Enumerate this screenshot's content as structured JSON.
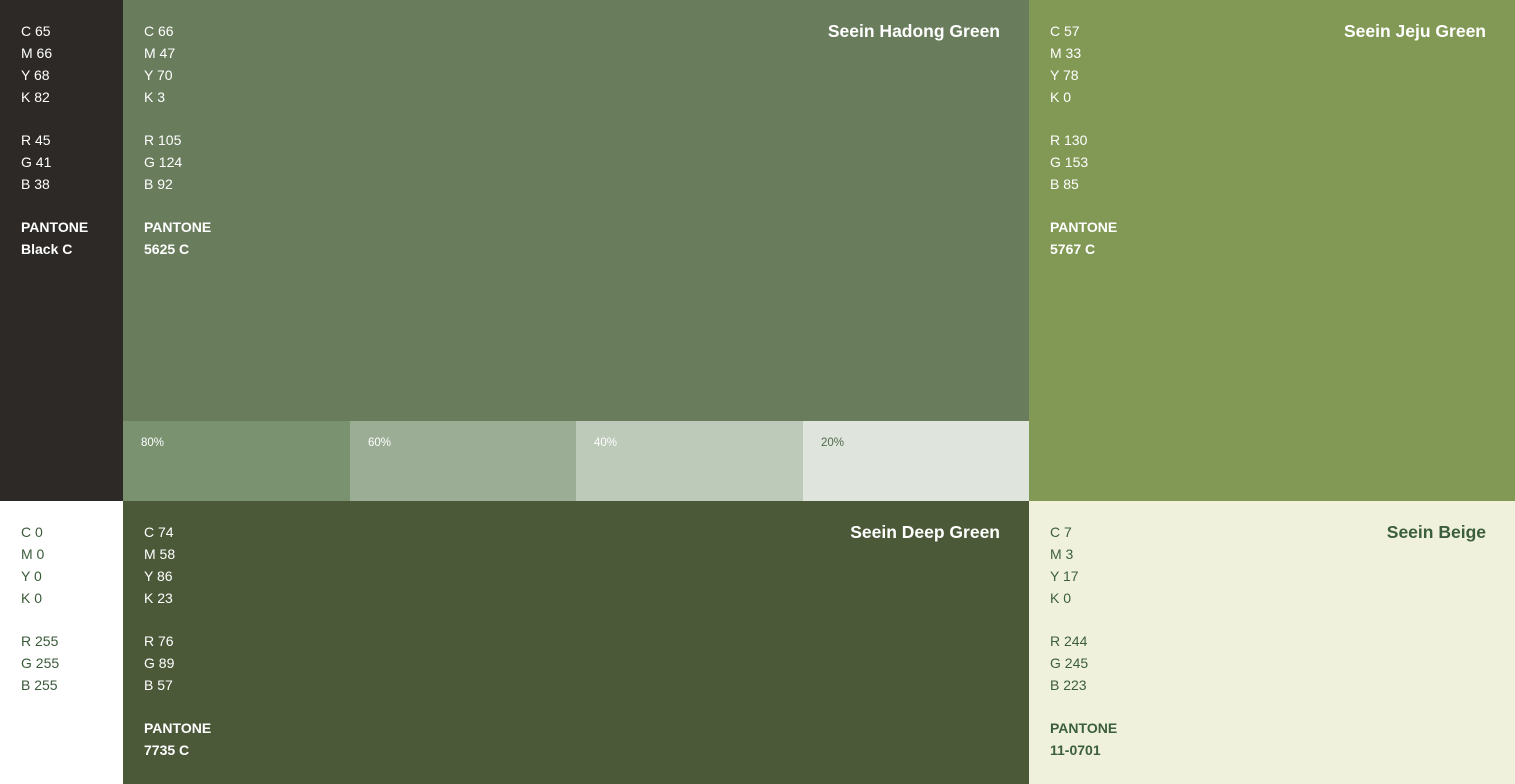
{
  "swatches": {
    "black": {
      "cmyk": [
        "C 65",
        "M 66",
        "Y 68",
        "K 82"
      ],
      "rgb": [
        "R 45",
        "G 41",
        "B 38"
      ],
      "pantone": [
        "PANTONE",
        "Black C"
      ],
      "bg": "#2d2926",
      "fg": "#ffffff"
    },
    "hadong": {
      "name": "Seein Hadong Green",
      "cmyk": [
        "C 66",
        "M 47",
        "Y 70",
        "K 3"
      ],
      "rgb": [
        "R 105",
        "G 124",
        "B 92"
      ],
      "pantone": [
        "PANTONE",
        "5625 C"
      ],
      "bg": "#697c5c",
      "fg": "#ffffff",
      "tints": [
        {
          "label": "80%",
          "color": "#7a9270"
        },
        {
          "label": "60%",
          "color": "#9bae95"
        },
        {
          "label": "40%",
          "color": "#bdc9b9"
        },
        {
          "label": "20%",
          "color": "#dfe4dd"
        }
      ]
    },
    "jeju": {
      "name": "Seein Jeju Green",
      "cmyk": [
        "C 57",
        "M 33",
        "Y 78",
        "K 0"
      ],
      "rgb": [
        "R 130",
        "G 153",
        "B 85"
      ],
      "pantone": [
        "PANTONE",
        "5767 C"
      ],
      "bg": "#829955",
      "fg": "#ffffff"
    },
    "white": {
      "cmyk": [
        "C 0",
        "M 0",
        "Y 0",
        "K 0"
      ],
      "rgb": [
        "R 255",
        "G 255",
        "B 255"
      ],
      "bg": "#ffffff",
      "fg": "#3a5a3a"
    },
    "deep": {
      "name": "Seein Deep Green",
      "cmyk": [
        "C 74",
        "M 58",
        "Y 86",
        "K 23"
      ],
      "rgb": [
        "R 76",
        "G 89",
        "B 57"
      ],
      "pantone": [
        "PANTONE",
        "7735 C"
      ],
      "bg": "#4c5939",
      "fg": "#ffffff"
    },
    "beige": {
      "name": "Seein Beige",
      "cmyk": [
        "C 7",
        "M 3",
        "Y 17",
        "K 0"
      ],
      "rgb": [
        "R 244",
        "G 245",
        "B 223"
      ],
      "pantone": [
        "PANTONE",
        "11-0701"
      ],
      "bg": "#f0f1dc",
      "fg": "#3b5e3b"
    }
  }
}
